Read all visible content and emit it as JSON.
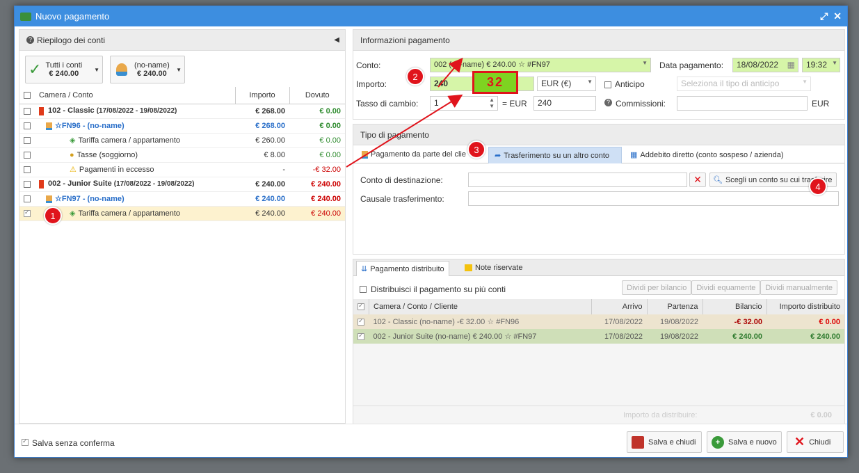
{
  "dialog": {
    "title": "Nuovo pagamento"
  },
  "left_panel": {
    "title": "Riepilogo dei conti",
    "all_accounts_label": "Tutti i conti",
    "all_accounts_amount": "€ 240.00",
    "client_label": "(no-name)",
    "client_amount": "€ 240.00",
    "columns": [
      "Camera / Conto",
      "Importo",
      "Dovuto"
    ],
    "rows": [
      {
        "label": "102 - Classic",
        "dates": "(17/08/2022 - 19/08/2022)",
        "importo": "€ 268.00",
        "dovuto": "€ 0.00"
      },
      {
        "label": "☆FN96 - (no-name)",
        "importo": "€ 268.00",
        "dovuto": "€ 0.00"
      },
      {
        "label": "Tariffa camera / appartamento",
        "importo": "€ 260.00",
        "dovuto": "€ 0.00"
      },
      {
        "label": "Tasse (soggiorno)",
        "importo": "€ 8.00",
        "dovuto": "€ 0.00"
      },
      {
        "label": "Pagamenti in eccesso",
        "importo": "-",
        "dovuto": "-€ 32.00"
      },
      {
        "label": "002 - Junior Suite",
        "dates": "(17/08/2022 - 19/08/2022)",
        "importo": "€ 240.00",
        "dovuto": "€ 240.00"
      },
      {
        "label": "☆FN97 - (no-name)",
        "importo": "€ 240.00",
        "dovuto": "€ 240.00"
      },
      {
        "label": "Tariffa camera / appartamento",
        "importo": "€ 240.00",
        "dovuto": "€ 240.00"
      }
    ]
  },
  "payment_info": {
    "title": "Informazioni pagamento",
    "conto_label": "Conto:",
    "conto_value": "002 (no-name) € 240.00 ☆ #FN97",
    "importo_label": "Importo:",
    "importo_value": "240",
    "highlight_value": "32",
    "currency": "EUR (€)",
    "anticipo_label": "Anticipo",
    "anticipo_placeholder": "Seleziona il tipo di anticipo",
    "data_label": "Data pagamento:",
    "date_value": "18/08/2022",
    "time_value": "19:32",
    "tasso_label": "Tasso di cambio:",
    "tasso_value": "1",
    "eq_label": "= EUR",
    "eq_value": "240",
    "commissioni_label": "Commissioni:",
    "commissioni_currency": "EUR"
  },
  "payment_type": {
    "title": "Tipo di pagamento",
    "tabs": [
      "Pagamento da parte del clie",
      "Trasferimento su un altro conto",
      "Addebito diretto (conto sospeso / azienda)"
    ],
    "dest_label": "Conto di destinazione:",
    "choose_button": "Scegli un conto su cui trasferire",
    "causale_label": "Causale trasferimento:"
  },
  "distribution": {
    "tabs": [
      "Pagamento distribuito",
      "Note riservate"
    ],
    "checkbox_label": "Distribuisci il pagamento su più conti",
    "buttons": [
      "Dividi per bilancio",
      "Dividi equamente",
      "Dividi manualmente"
    ],
    "columns": [
      "Camera / Conto / Cliente",
      "Arrivo",
      "Partenza",
      "Bilancio",
      "Importo distribuito"
    ],
    "rows": [
      {
        "label": "102 - Classic (no-name) -€ 32.00 ☆ #FN96",
        "arrivo": "17/08/2022",
        "partenza": "19/08/2022",
        "bilancio": "-€ 32.00",
        "importo": "€ 0.00"
      },
      {
        "label": "002 - Junior Suite (no-name) € 240.00 ☆ #FN97",
        "arrivo": "17/08/2022",
        "partenza": "19/08/2022",
        "bilancio": "€ 240.00",
        "importo": "€ 240.00"
      }
    ],
    "footer_label": "Importo da distribuire:",
    "footer_value": "€ 0.00"
  },
  "footer": {
    "save_no_confirm": "Salva senza conferma",
    "save_close": "Salva e chiudi",
    "save_new": "Salva e nuovo",
    "close": "Chiudi"
  },
  "annotations": [
    "1",
    "2",
    "3",
    "4"
  ]
}
